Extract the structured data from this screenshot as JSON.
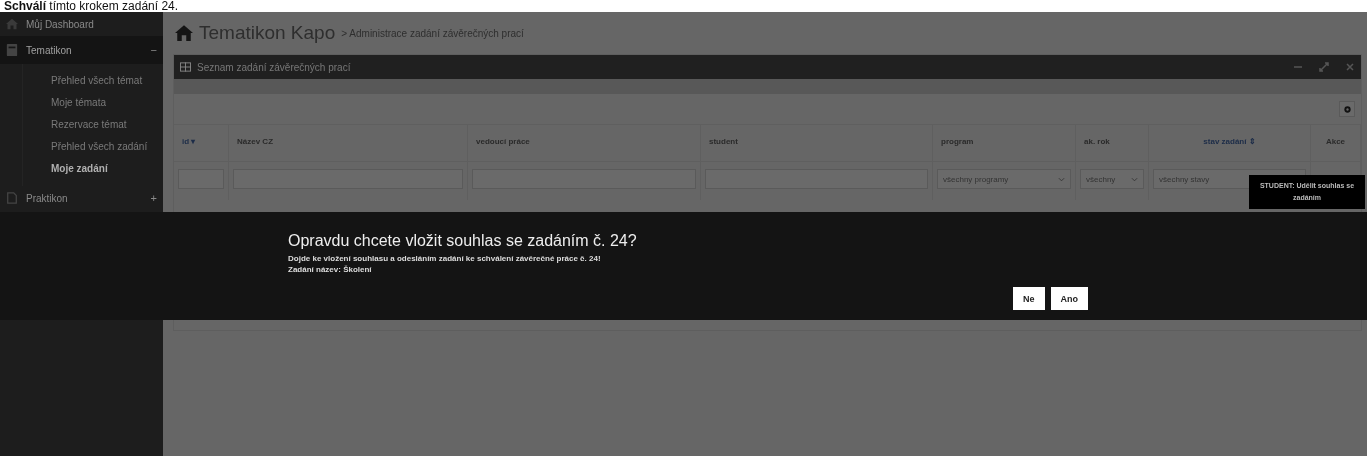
{
  "caption": "**Schválí** tímto krokem zadání 24.",
  "sidebar": {
    "items": [
      {
        "label": "Můj Dashboard",
        "expanded": false
      },
      {
        "label": "Tematikon",
        "toggle": "−",
        "expanded": true,
        "children": [
          {
            "label": "Přehled všech témat",
            "selected": false
          },
          {
            "label": "Moje témata",
            "selected": false
          },
          {
            "label": "Rezervace témat",
            "selected": false
          },
          {
            "label": "Přehled všech zadání",
            "selected": false
          },
          {
            "label": "Moje zadání",
            "selected": true
          }
        ]
      },
      {
        "label": "Praktikon",
        "toggle": "+",
        "expanded": false
      }
    ]
  },
  "breadcrumb": {
    "title": "Tematikon Kapo",
    "path": "> Administrace zadání závěrečných prací"
  },
  "panel": {
    "title": "Seznam zadání závěrečných prací"
  },
  "table": {
    "columns": [
      {
        "label": "id ▾",
        "kind": "sort"
      },
      {
        "label": "Název CZ",
        "kind": "plain"
      },
      {
        "label": "vedoucí práce",
        "kind": "plain"
      },
      {
        "label": "student",
        "kind": "plain"
      },
      {
        "label": "program",
        "kind": "plain"
      },
      {
        "label": "ak. rok",
        "kind": "plain"
      },
      {
        "label": "stav zadání ⇕",
        "kind": "link"
      },
      {
        "label": "Akce",
        "kind": "center"
      }
    ],
    "filters": [
      {
        "kind": "input"
      },
      {
        "kind": "input"
      },
      {
        "kind": "input"
      },
      {
        "kind": "input"
      },
      {
        "kind": "select",
        "value": "všechny programy"
      },
      {
        "kind": "select",
        "value": "všechny"
      },
      {
        "kind": "text",
        "value": "všechny stavy"
      },
      {
        "kind": "none"
      }
    ]
  },
  "tooltip": "STUDENT: Udělit souhlas se zadáním",
  "dialog": {
    "title": "Opravdu chcete vložit souhlas se zadáním č. 24?",
    "message": "Dojde ke vložení souhlasu a odesláním zadání ke schválení závěrečné práce č. 24!",
    "detail": "Zadání název: Školení",
    "buttons": [
      "Ne",
      "Ano"
    ]
  }
}
